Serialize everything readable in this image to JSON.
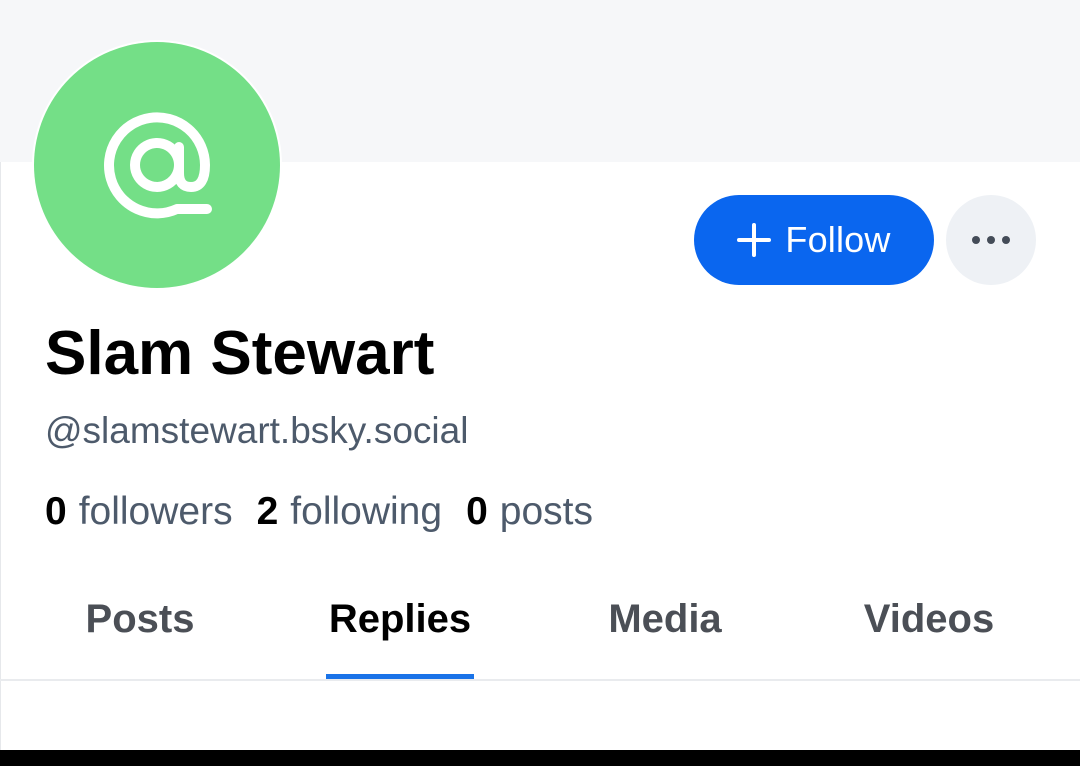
{
  "profile": {
    "display_name": "Slam Stewart",
    "handle": "@slamstewart.bsky.social",
    "avatar": {
      "icon": "at-sign-icon",
      "background_color": "#74df87"
    }
  },
  "actions": {
    "follow_label": "Follow",
    "follow_icon": "plus-icon",
    "more_icon": "ellipsis-icon",
    "accent_color": "#0a66ef"
  },
  "stats": {
    "followers": {
      "count": "0",
      "label": "followers"
    },
    "following": {
      "count": "2",
      "label": "following"
    },
    "posts": {
      "count": "0",
      "label": "posts"
    }
  },
  "tabs": [
    {
      "label": "Posts",
      "active": false
    },
    {
      "label": "Replies",
      "active": true
    },
    {
      "label": "Media",
      "active": false
    },
    {
      "label": "Videos",
      "active": false
    }
  ]
}
